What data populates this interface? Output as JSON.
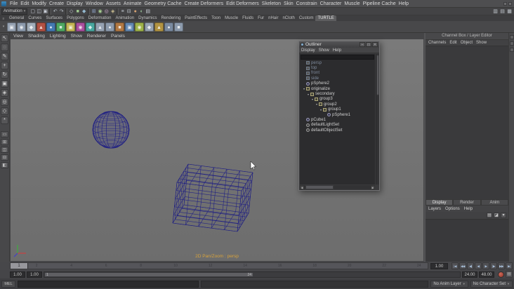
{
  "menubar": {
    "menus": [
      "File",
      "Edit",
      "Modify",
      "Create",
      "Display",
      "Window",
      "Assets",
      "Animate",
      "Geometry Cache",
      "Create Deformers",
      "Edit Deformers",
      "Skeleton",
      "Skin",
      "Constrain",
      "Character",
      "Muscle",
      "Pipeline Cache",
      "Help"
    ],
    "right_icons": [
      {
        "name": "ui-toggle-icon-1"
      },
      {
        "name": "ui-toggle-icon-2"
      }
    ]
  },
  "status_line": {
    "menuset": "Animation",
    "icons": [
      {
        "name": "new-scene-icon",
        "glyph": "▢",
        "color": "#c9ced6"
      },
      {
        "name": "open-scene-icon",
        "glyph": "◫",
        "color": "#c9ced6"
      },
      {
        "name": "save-scene-icon",
        "glyph": "▣",
        "color": "#c9ced6"
      },
      {
        "name": "divider"
      },
      {
        "name": "undo-icon",
        "glyph": "↶",
        "color": "#bac1c9"
      },
      {
        "name": "redo-icon",
        "glyph": "↷",
        "color": "#bac1c9"
      },
      {
        "name": "divider"
      },
      {
        "name": "select-hierarchy-icon",
        "glyph": "◇",
        "color": "#c2c8cf"
      },
      {
        "name": "select-object-icon",
        "glyph": "■",
        "color": "#a3cf93"
      },
      {
        "name": "select-component-icon",
        "glyph": "◆",
        "color": "#93b9cf"
      },
      {
        "name": "divider"
      },
      {
        "name": "snap-to-grid-icon",
        "glyph": "⊞",
        "color": "#93a9cf"
      },
      {
        "name": "snap-to-curve-icon",
        "glyph": "◉",
        "color": "#a9cf93"
      },
      {
        "name": "snap-to-point-icon",
        "glyph": "◎",
        "color": "#cfa9cf"
      },
      {
        "name": "snap-to-plane-icon",
        "glyph": "◈",
        "color": "#cfc293"
      },
      {
        "name": "divider"
      },
      {
        "name": "input-operations-icon",
        "glyph": "≡",
        "color": "#c2c8cf"
      },
      {
        "name": "construction-history-icon",
        "glyph": "⊟",
        "color": "#c2c8cf"
      },
      {
        "name": "render-view-icon",
        "glyph": "●",
        "color": "#d8a273"
      },
      {
        "name": "ipr-render-icon",
        "glyph": "◐",
        "color": "#9cc89c"
      },
      {
        "name": "render-settings-icon",
        "glyph": "▤",
        "color": "#c6ccd2"
      }
    ],
    "right_icons": [
      {
        "name": "attribute-editor-toggle-icon",
        "glyph": "▥"
      },
      {
        "name": "tool-settings-toggle-icon",
        "glyph": "▤"
      },
      {
        "name": "channel-box-toggle-icon",
        "glyph": "▦"
      }
    ]
  },
  "shelf": {
    "tabs": [
      "General",
      "Curves",
      "Surfaces",
      "Polygons",
      "Deformation",
      "Animation",
      "Dynamics",
      "Rendering",
      "PaintEffects",
      "Toon",
      "Muscle",
      "Fluids",
      "Fur",
      "nHair",
      "nCloth",
      "Custom",
      "TURTLE"
    ],
    "active_tab": "TURTLE",
    "icons": [
      {
        "name": "shelf-button-1",
        "glyph": "▣",
        "color": "#96a2b2"
      },
      {
        "name": "shelf-button-2",
        "glyph": "◉",
        "color": "#8c9aac"
      },
      {
        "name": "shelf-button-3",
        "glyph": "◆",
        "color": "#a2aeba"
      },
      {
        "name": "shelf-button-4",
        "glyph": "▲",
        "color": "#b25143"
      },
      {
        "name": "shelf-button-5",
        "glyph": "●",
        "color": "#4379b2"
      },
      {
        "name": "shelf-button-6",
        "glyph": "■",
        "color": "#4fa862"
      },
      {
        "name": "shelf-button-7",
        "glyph": "▣",
        "color": "#c4b553"
      },
      {
        "name": "shelf-button-8",
        "glyph": "◉",
        "color": "#aa4f9e"
      },
      {
        "name": "shelf-button-9",
        "glyph": "◆",
        "color": "#49a8a0"
      },
      {
        "name": "shelf-button-10",
        "glyph": "▲",
        "color": "#96a2b2"
      },
      {
        "name": "shelf-button-11",
        "glyph": "●",
        "color": "#8c9aac"
      },
      {
        "name": "shelf-button-12",
        "glyph": "■",
        "color": "#b27943"
      },
      {
        "name": "shelf-button-13",
        "glyph": "▣",
        "color": "#6287b2"
      },
      {
        "name": "shelf-button-14",
        "glyph": "◉",
        "color": "#9eb249"
      },
      {
        "name": "shelf-button-15",
        "glyph": "◆",
        "color": "#96a2b2"
      },
      {
        "name": "shelf-button-16",
        "glyph": "▲",
        "color": "#b29443"
      },
      {
        "name": "shelf-button-17",
        "glyph": "●",
        "color": "#7a8aa0"
      },
      {
        "name": "shelf-button-18",
        "glyph": "■",
        "color": "#8c9aac"
      }
    ]
  },
  "toolbox": {
    "tools": [
      {
        "name": "select-tool-icon",
        "glyph": "↖"
      },
      {
        "name": "lasso-tool-icon",
        "glyph": "◌"
      },
      {
        "name": "paint-select-tool-icon",
        "glyph": "✎"
      },
      {
        "name": "move-tool-icon",
        "glyph": "+"
      },
      {
        "name": "rotate-tool-icon",
        "glyph": "↻"
      },
      {
        "name": "scale-tool-icon",
        "glyph": "▣"
      },
      {
        "name": "universal-manipulator-icon",
        "glyph": "◈"
      },
      {
        "name": "soft-modification-icon",
        "glyph": "◎"
      },
      {
        "name": "show-manipulator-icon",
        "glyph": "◇"
      },
      {
        "name": "last-tool-icon",
        "glyph": "*"
      }
    ],
    "layouts": [
      {
        "name": "single-pane-layout-button",
        "glyph": "▭"
      },
      {
        "name": "four-pane-layout-button",
        "glyph": "⊞"
      },
      {
        "name": "persp-outliner-layout-button",
        "glyph": "◫"
      },
      {
        "name": "persp-graph-layout-button",
        "glyph": "⊟"
      },
      {
        "name": "hypershade-persp-layout-button",
        "glyph": "◧"
      }
    ]
  },
  "viewport": {
    "menus": [
      "View",
      "Shading",
      "Lighting",
      "Show",
      "Renderer",
      "Panels"
    ],
    "hud": "2D Pan/Zoom : persp",
    "camera": "persp"
  },
  "outliner": {
    "title": "Outliner",
    "window_buttons": [
      {
        "name": "minimize-window-button",
        "glyph": "–"
      },
      {
        "name": "maximize-window-button",
        "glyph": "□"
      },
      {
        "name": "close-window-button",
        "glyph": "×"
      }
    ],
    "menus": [
      "Display",
      "Show",
      "Help"
    ],
    "filter_value": "",
    "items": [
      {
        "label": "persp",
        "level": 0,
        "type": "camera",
        "dim": true
      },
      {
        "label": "top",
        "level": 0,
        "type": "camera",
        "dim": true
      },
      {
        "label": "front",
        "level": 0,
        "type": "camera",
        "dim": true
      },
      {
        "label": "side",
        "level": 0,
        "type": "camera",
        "dim": true
      },
      {
        "label": "pSphere2",
        "level": 0,
        "type": "mesh"
      },
      {
        "label": "originalize",
        "level": 0,
        "type": "group",
        "expanded": true
      },
      {
        "label": "secondary",
        "level": 1,
        "type": "group",
        "expanded": true
      },
      {
        "label": "group3",
        "level": 2,
        "type": "group",
        "expanded": true
      },
      {
        "label": "group2",
        "level": 3,
        "type": "group",
        "expanded": true
      },
      {
        "label": "group1",
        "level": 4,
        "type": "group",
        "expanded": true
      },
      {
        "label": "pSphere1",
        "level": 5,
        "type": "mesh"
      },
      {
        "label": "pCube1",
        "level": 0,
        "type": "mesh"
      },
      {
        "label": "defaultLightSet",
        "level": 0,
        "type": "set"
      },
      {
        "label": "defaultObjectSet",
        "level": 0,
        "type": "set"
      }
    ]
  },
  "channel_box": {
    "header": "Channel Box / Layer Editor",
    "menus": [
      "Channels",
      "Edit",
      "Object",
      "Show"
    ]
  },
  "layer_editor": {
    "tabs": [
      "Display",
      "Render",
      "Anim"
    ],
    "active_tab": "Display",
    "menus": [
      "Layers",
      "Options",
      "Help"
    ],
    "toolbar_icons": [
      {
        "name": "create-empty-layer-icon",
        "glyph": "▤"
      },
      {
        "name": "create-layer-from-selected-icon",
        "glyph": "◪"
      },
      {
        "name": "layer-options-icon",
        "glyph": "▾"
      }
    ]
  },
  "sidestrip_icons": [
    {
      "name": "attribute-editor-tab-icon"
    },
    {
      "name": "tool-settings-tab-icon"
    },
    {
      "name": "channel-box-tab-icon"
    }
  ],
  "time_slider": {
    "current_frame": "1",
    "current_time_field": "1.00",
    "ticks": [
      "2",
      "4",
      "6",
      "8",
      "10",
      "12",
      "14",
      "16",
      "18",
      "20",
      "22",
      "24"
    ]
  },
  "playback": {
    "buttons": [
      {
        "name": "go-to-start-button",
        "glyph": "|◀"
      },
      {
        "name": "step-back-frame-button",
        "glyph": "◀◀"
      },
      {
        "name": "step-back-key-button",
        "glyph": "◀|"
      },
      {
        "name": "play-backwards-button",
        "glyph": "◀"
      },
      {
        "name": "play-forwards-button",
        "glyph": "▶"
      },
      {
        "name": "step-forward-key-button",
        "glyph": "|▶"
      },
      {
        "name": "step-forward-frame-button",
        "glyph": "▶▶"
      },
      {
        "name": "go-to-end-button",
        "glyph": "▶|"
      }
    ]
  },
  "range_slider": {
    "anim_start_field": "1.00",
    "playback_start_field": "1.00",
    "handle_start": "1",
    "handle_end": "24",
    "playback_end_field": "24.00",
    "anim_end_field": "48.00"
  },
  "command_line": {
    "label": "MEL",
    "anim_layer": "No Anim Layer",
    "character_set": "No Character Set"
  },
  "colors": {
    "wireframe": "#1d1d84",
    "hud_text": "#d8a33c",
    "viewport_bg": "#747474",
    "axis_x": "#cc4040",
    "axis_y": "#3fae3f",
    "axis_z": "#4040cc"
  }
}
